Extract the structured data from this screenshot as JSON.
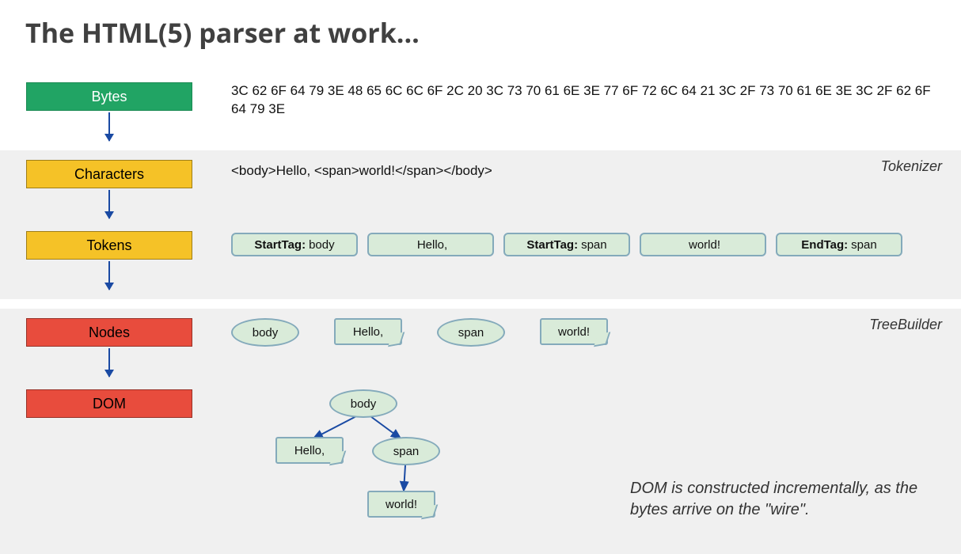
{
  "title": "The HTML(5) parser at work...",
  "section_labels": {
    "tokenizer": "Tokenizer",
    "treebuilder": "TreeBuilder"
  },
  "stages": {
    "bytes": "Bytes",
    "characters": "Characters",
    "tokens": "Tokens",
    "nodes": "Nodes",
    "dom": "DOM"
  },
  "bytes_hex": "3C 62 6F 64 79 3E 48 65 6C 6C 6F 2C 20 3C 73 70 61 6E 3E 77 6F 72 6C 64 21 3C 2F 73 70 61 6E 3E 3C 2F 62 6F 64 79 3E",
  "characters_text": "<body>Hello, <span>world!</span></body>",
  "tokens": [
    {
      "prefix": "StartTag:",
      "value": "body"
    },
    {
      "prefix": "",
      "value": "Hello,"
    },
    {
      "prefix": "StartTag:",
      "value": "span"
    },
    {
      "prefix": "",
      "value": "world!"
    },
    {
      "prefix": "EndTag:",
      "value": "span"
    }
  ],
  "nodes": [
    "body",
    "Hello,",
    "span",
    "world!"
  ],
  "dom_tree": {
    "root": "body",
    "children": [
      {
        "label": "Hello,",
        "type": "text"
      },
      {
        "label": "span",
        "type": "element",
        "children": [
          {
            "label": "world!",
            "type": "text"
          }
        ]
      }
    ]
  },
  "dom_caption": "DOM is constructed incrementally, as the bytes arrive on the \"wire\"."
}
